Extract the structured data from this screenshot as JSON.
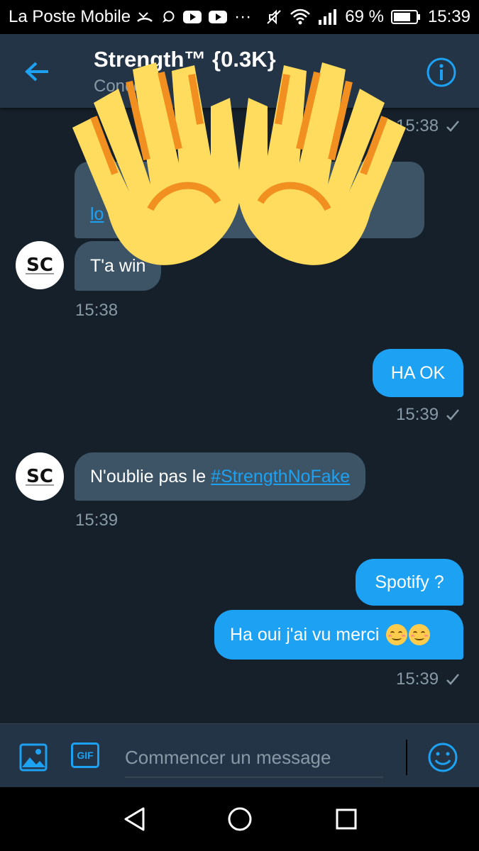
{
  "status_bar": {
    "carrier": "La Poste Mobile",
    "overflow": "···",
    "battery": "69 %",
    "time": "15:39"
  },
  "header": {
    "title": "Strength™ {0.3K}",
    "subtitle": "Concour"
  },
  "messages": {
    "partial_link": "lo",
    "ts_top": "15:38",
    "recv_1": "T'a win",
    "ts_1": "15:38",
    "sent_1": "HA OK",
    "ts_2": "15:39",
    "recv_2_text": "N'oublie pas le ",
    "recv_2_hashtag": "#StrengthNoFake",
    "ts_3": "15:39",
    "sent_2": "Spotify ?",
    "sent_3": "Ha oui j'ai vu merci",
    "ts_4": "15:39"
  },
  "avatar": {
    "initials": "SC"
  },
  "composer": {
    "placeholder": "Commencer un message",
    "gif_label": "GIF"
  },
  "icons": {
    "back": "arrow-left-icon",
    "info": "info-icon",
    "media": "image-icon",
    "gif": "gif-icon",
    "emoji": "emoji-icon",
    "sticker": "raising-hands-emoji",
    "nav_back": "triangle-back-icon",
    "nav_home": "circle-home-icon",
    "nav_recent": "square-recents-icon"
  },
  "colors": {
    "accent": "#1da1f2",
    "background": "#15202b",
    "header": "#243447",
    "received_bubble": "#3d5466",
    "muted_text": "#8899a6"
  }
}
